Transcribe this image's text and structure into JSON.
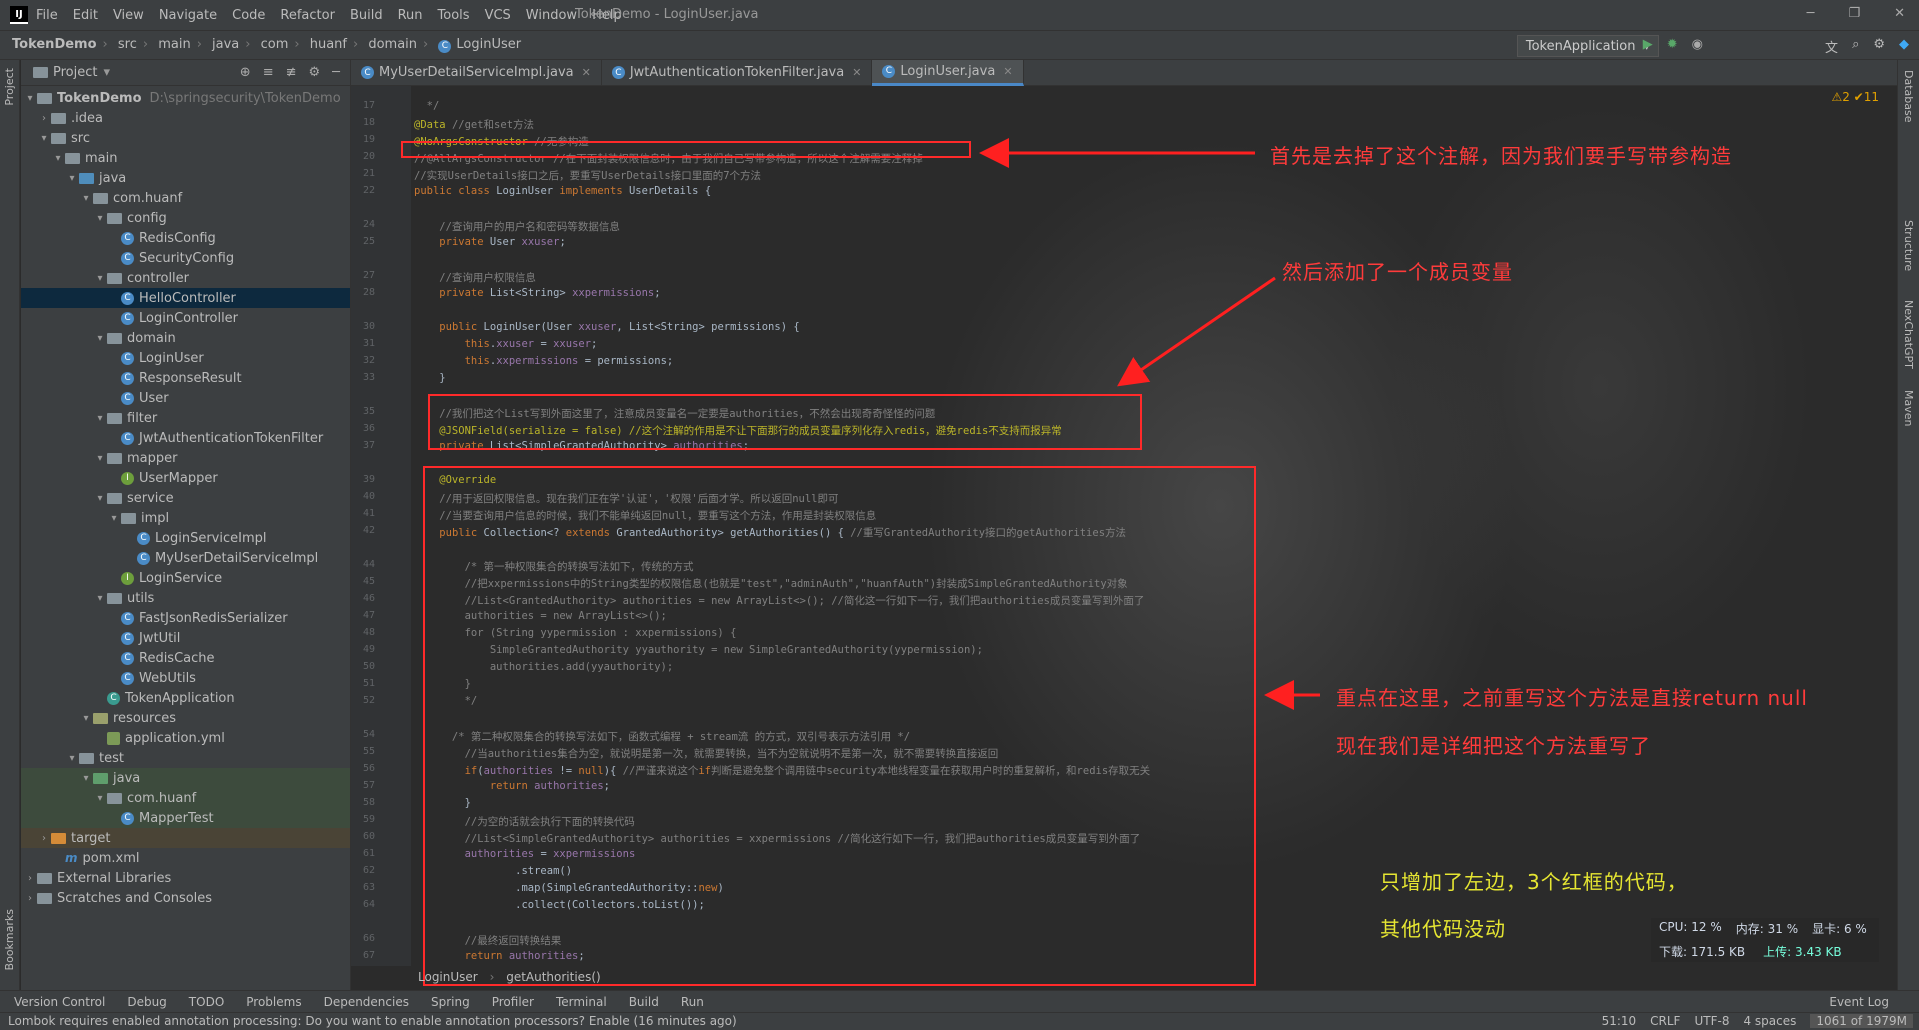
{
  "titlebar": {
    "menus": [
      "File",
      "Edit",
      "View",
      "Navigate",
      "Code",
      "Refactor",
      "Build",
      "Run",
      "Tools",
      "VCS",
      "Window",
      "Help"
    ],
    "title": "TokenDemo - LoginUser.java"
  },
  "navbar": {
    "crumbs": [
      "TokenDemo",
      "src",
      "main",
      "java",
      "com",
      "huanf",
      "domain",
      "LoginUser"
    ],
    "run_config": "TokenApplication"
  },
  "project_panel": {
    "title": "Project",
    "tree": [
      {
        "label": "TokenDemo",
        "hint": "D:\\springsecurity\\TokenDemo"
      },
      {
        "label": ".idea"
      },
      {
        "label": "src"
      },
      {
        "label": "main"
      },
      {
        "label": "java"
      },
      {
        "label": "com.huanf"
      },
      {
        "label": "config"
      },
      {
        "label": "RedisConfig"
      },
      {
        "label": "SecurityConfig"
      },
      {
        "label": "controller"
      },
      {
        "label": "HelloController"
      },
      {
        "label": "LoginController"
      },
      {
        "label": "domain"
      },
      {
        "label": "LoginUser"
      },
      {
        "label": "ResponseResult"
      },
      {
        "label": "User"
      },
      {
        "label": "filter"
      },
      {
        "label": "JwtAuthenticationTokenFilter"
      },
      {
        "label": "mapper"
      },
      {
        "label": "UserMapper"
      },
      {
        "label": "service"
      },
      {
        "label": "impl"
      },
      {
        "label": "LoginServiceImpl"
      },
      {
        "label": "MyUserDetailServiceImpl"
      },
      {
        "label": "LoginService"
      },
      {
        "label": "utils"
      },
      {
        "label": "FastJsonRedisSerializer"
      },
      {
        "label": "JwtUtil"
      },
      {
        "label": "RedisCache"
      },
      {
        "label": "WebUtils"
      },
      {
        "label": "TokenApplication"
      },
      {
        "label": "resources"
      },
      {
        "label": "application.yml"
      },
      {
        "label": "test"
      },
      {
        "label": "java"
      },
      {
        "label": "com.huanf"
      },
      {
        "label": "MapperTest"
      },
      {
        "label": "target"
      },
      {
        "label": "pom.xml"
      },
      {
        "label": "External Libraries"
      },
      {
        "label": "Scratches and Consoles"
      }
    ]
  },
  "tabs": [
    "MyUserDetailServiceImpl.java",
    "JwtAuthenticationTokenFilter.java",
    "LoginUser.java"
  ],
  "editor": {
    "inspections": "⚠2 ✔11",
    "bottom_crumbs": [
      "LoginUser",
      "getAuthorities()"
    ]
  },
  "annotations": {
    "a1": "首先是去掉了这个注解，因为我们要手写带参构造",
    "a2": "然后添加了一个成员变量",
    "a3": "重点在这里，之前重写这个方法是直接return null",
    "a4": "现在我们是详细把这个方法重写了",
    "a5": "只增加了左边，3个红框的代码，",
    "a6": "其他代码没动"
  },
  "sysmon": {
    "cpu": "CPU: 12 %",
    "mem": "内存: 31 %",
    "gpu": "显卡: 6 %",
    "down": "下载: 171.5 KB",
    "up": "上传: 3.43 KB"
  },
  "bottom_tools": [
    "Version Control",
    "Debug",
    "TODO",
    "Problems",
    "Dependencies",
    "Spring",
    "Profiler",
    "Terminal",
    "Build",
    "Run",
    "Event Log"
  ],
  "status": {
    "message": "Lombok requires enabled annotation processing: Do you want to enable annotation processors? Enable (16 minutes ago)",
    "position": "51:10",
    "line_sep": "CRLF",
    "encoding": "UTF-8",
    "indent": "4 spaces",
    "memory": "1061 of 1979M"
  },
  "right_strip": [
    "Database",
    "Structure",
    "NexChatGPT",
    "Maven"
  ],
  "left_strip": [
    "Project",
    "Bookmarks"
  ]
}
